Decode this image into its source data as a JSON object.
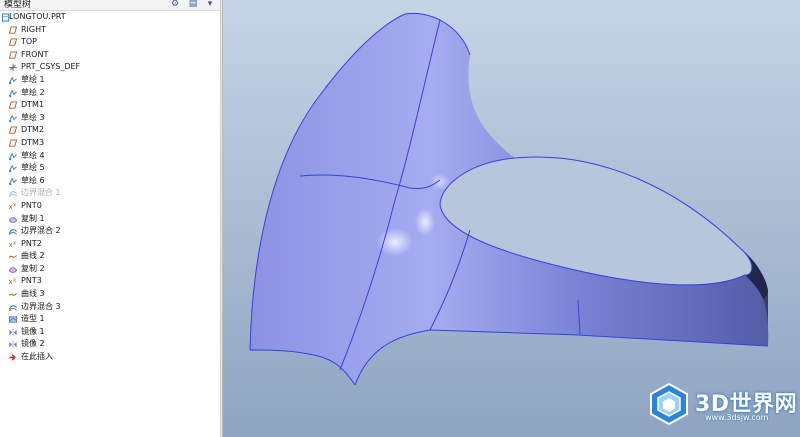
{
  "tree": {
    "header_title": "模型树",
    "root_label": "LONGTOU.PRT",
    "items": [
      {
        "label": "RIGHT",
        "icon": "datum-plane-icon",
        "dim": false
      },
      {
        "label": "TOP",
        "icon": "datum-plane-icon",
        "dim": false
      },
      {
        "label": "FRONT",
        "icon": "datum-plane-icon",
        "dim": false
      },
      {
        "label": "PRT_CSYS_DEF",
        "icon": "csys-icon",
        "dim": false
      },
      {
        "label": "草绘 1",
        "icon": "sketch-icon",
        "dim": false
      },
      {
        "label": "草绘 2",
        "icon": "sketch-icon",
        "dim": false
      },
      {
        "label": "DTM1",
        "icon": "datum-plane-icon",
        "dim": false
      },
      {
        "label": "草绘 3",
        "icon": "sketch-icon",
        "dim": false
      },
      {
        "label": "DTM2",
        "icon": "datum-plane-icon",
        "dim": false
      },
      {
        "label": "DTM3",
        "icon": "datum-plane-icon",
        "dim": false
      },
      {
        "label": "草绘 4",
        "icon": "sketch-icon",
        "dim": false
      },
      {
        "label": "草绘 5",
        "icon": "sketch-icon",
        "dim": false
      },
      {
        "label": "草绘 6",
        "icon": "sketch-icon",
        "dim": false
      },
      {
        "label": "边界混合 1",
        "icon": "boundary-blend-icon",
        "dim": true
      },
      {
        "label": "PNT0",
        "icon": "datum-point-icon",
        "dim": false
      },
      {
        "label": "复制 1",
        "icon": "copy-surface-icon",
        "dim": false
      },
      {
        "label": "边界混合 2",
        "icon": "boundary-blend-icon",
        "dim": false
      },
      {
        "label": "PNT2",
        "icon": "datum-point-icon",
        "dim": false
      },
      {
        "label": "曲线 2",
        "icon": "curve-icon",
        "dim": false
      },
      {
        "label": "复制 2",
        "icon": "copy-surface-icon",
        "dim": false
      },
      {
        "label": "PNT3",
        "icon": "datum-point-icon",
        "dim": false
      },
      {
        "label": "曲线 3",
        "icon": "curve-icon",
        "dim": false
      },
      {
        "label": "边界混合 3",
        "icon": "boundary-blend-icon",
        "dim": false
      },
      {
        "label": "造型 1",
        "icon": "style-icon",
        "dim": false
      },
      {
        "label": "镜像 1",
        "icon": "mirror-icon",
        "dim": false
      },
      {
        "label": "镜像 2",
        "icon": "mirror-icon",
        "dim": false
      },
      {
        "label": "在此插入",
        "icon": "insert-here-arrow-icon",
        "dim": false
      }
    ]
  },
  "watermark": {
    "text": "3D世界网",
    "url": "www.3dsjw.com"
  },
  "colors": {
    "surface_light": "#a3a9ee",
    "surface_mid": "#6b74cc",
    "surface_dark": "#2b2f55",
    "edge_blue": "#3a3fe0",
    "accent": "#3a5a9a",
    "background_top": "#c5d4e6",
    "background_bottom": "#8ea4c1",
    "insert_arrow": "#c0262b"
  }
}
